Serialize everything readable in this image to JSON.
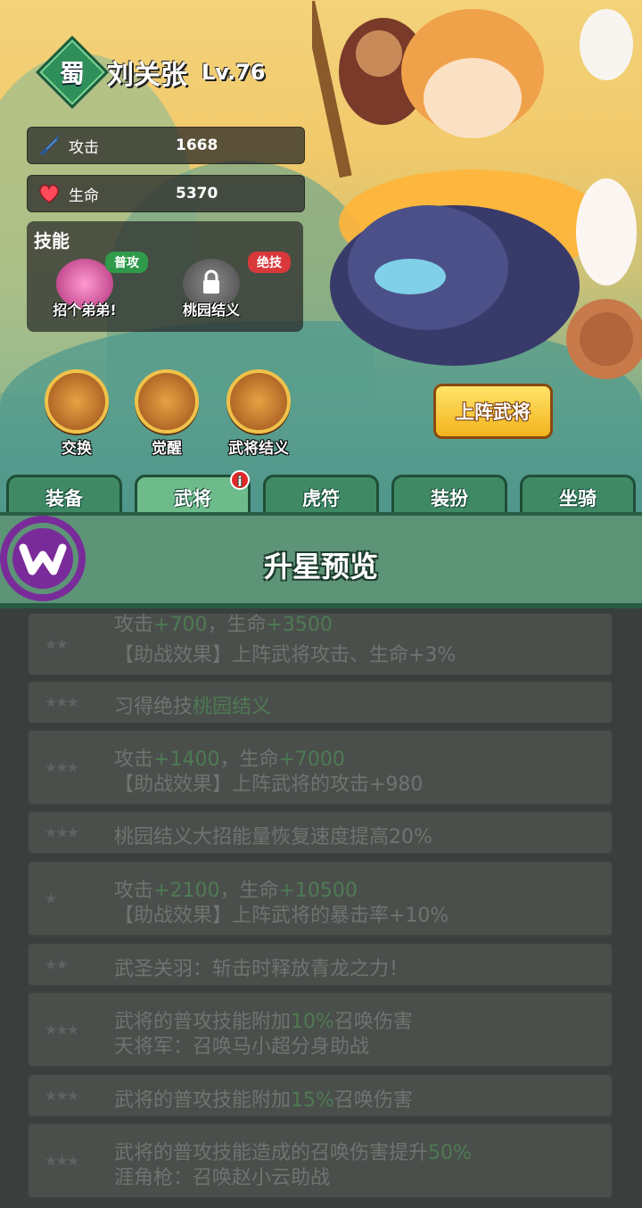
{
  "hero": {
    "kingdom": "蜀",
    "name": "刘关张",
    "level": "Lv.76"
  },
  "stats": [
    {
      "label": "攻击",
      "value": "1668",
      "icon": "sword-icon"
    },
    {
      "label": "生命",
      "value": "5370",
      "icon": "heart-icon"
    }
  ],
  "skills": {
    "title": "技能",
    "items": [
      {
        "name": "招个弟弟!",
        "tag": "普攻",
        "tag_color": "#2f9a4a"
      },
      {
        "name": "桃园结义",
        "tag": "绝技",
        "tag_color": "#d8383a",
        "locked": true
      }
    ]
  },
  "actions": [
    {
      "label": "交换"
    },
    {
      "label": "觉醒"
    },
    {
      "label": "武将结义"
    }
  ],
  "deploy_button": "上阵武将",
  "tabs": [
    {
      "label": "装备"
    },
    {
      "label": "武将",
      "badge": "i"
    },
    {
      "label": "虎符"
    },
    {
      "label": "装扮"
    },
    {
      "label": "坐骑"
    }
  ],
  "panel_title": "升星预览",
  "preview": {
    "item1": {
      "l1a": "攻击",
      "l1b": "+700",
      "l1c": "，生命",
      "l1d": "+3500",
      "l2": "【助战效果】上阵武将攻击、生命+3%"
    },
    "item2": {
      "a": "习得绝技",
      "b": "桃园结义"
    },
    "item3": {
      "l1a": "攻击",
      "l1b": "+1400",
      "l1c": "，生命",
      "l1d": "+7000",
      "l2": "【助战效果】上阵武将的攻击+980"
    },
    "item4": {
      "a": "桃园结义大招能量恢复速度提高20%"
    },
    "item5": {
      "l1a": "攻击",
      "l1b": "+2100",
      "l1c": "，生命",
      "l1d": "+10500",
      "l2": "【助战效果】上阵武将的暴击率+10%"
    },
    "item6": {
      "a": "武圣关羽：斩击时释放青龙之力！"
    },
    "item7": {
      "l1a": "武将的普攻技能附加",
      "l1b": "10%",
      "l1c": "召唤伤害",
      "l2": "天将军：召唤马小超分身助战"
    },
    "item8": {
      "a": "武将的普攻技能附加",
      "b": "15%",
      "c": "召唤伤害"
    },
    "item9": {
      "l1a": "武将的普攻技能造成的召唤伤害提升",
      "l1b": "50%",
      "l2": "涯角枪：召唤赵小云助战"
    }
  },
  "colors": {
    "accent_green": "#5d9477",
    "gold": "#f3b31c"
  }
}
